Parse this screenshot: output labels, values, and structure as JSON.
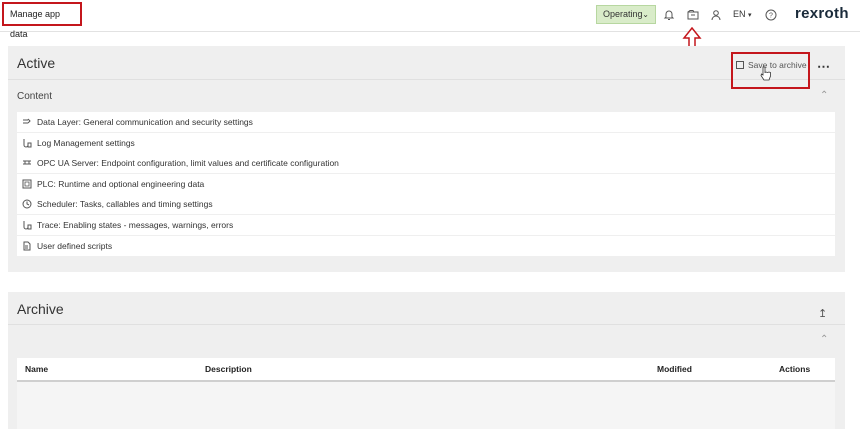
{
  "header": {
    "page_title": "Manage app data",
    "status_label": "Operating",
    "language": "EN",
    "logo": "rexroth",
    "icons": [
      "bell-icon",
      "archive-icon",
      "user-icon",
      "help-icon"
    ]
  },
  "active": {
    "title": "Active",
    "save_label": "Save to archive",
    "more_label": "⋯",
    "content_label": "Content",
    "items": [
      {
        "label": "Data Layer: General communication and security settings",
        "icon": "data-layer-icon"
      },
      {
        "label": "Log Management settings",
        "icon": "log-icon"
      },
      {
        "label": "OPC UA Server: Endpoint configuration, limit values and certificate configuration",
        "icon": "opcua-icon"
      },
      {
        "label": "PLC: Runtime and optional engineering data",
        "icon": "plc-icon"
      },
      {
        "label": "Scheduler: Tasks, callables and timing settings",
        "icon": "scheduler-icon"
      },
      {
        "label": "Trace: Enabling states - messages, warnings, errors",
        "icon": "trace-icon"
      },
      {
        "label": "User defined scripts",
        "icon": "script-icon"
      }
    ]
  },
  "archive": {
    "title": "Archive",
    "columns": {
      "name": "Name",
      "description": "Description",
      "modified": "Modified",
      "actions": "Actions"
    }
  },
  "colors": {
    "highlight": "#c4161c",
    "operating_bg": "#d9ecc9",
    "panel_bg": "#efefef"
  }
}
